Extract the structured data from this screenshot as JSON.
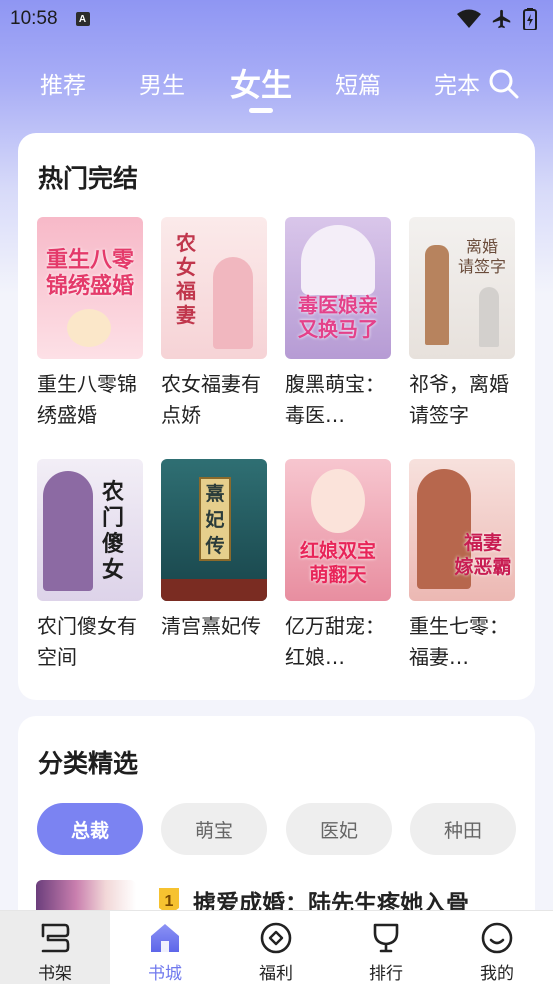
{
  "status_bar": {
    "time": "10:58",
    "notif_letter": "A"
  },
  "top_tabs": [
    {
      "label": "推荐",
      "active": false
    },
    {
      "label": "男生",
      "active": false
    },
    {
      "label": "女生",
      "active": true
    },
    {
      "label": "短篇",
      "active": false
    },
    {
      "label": "完本",
      "active": false
    }
  ],
  "hot_section": {
    "title": "热门完结",
    "books": [
      {
        "title": "重生八零锦绣盛婚",
        "cover_text": "重生八零锦绣盛婚",
        "cover_colors": [
          "#f7b9c8",
          "#fde0e6"
        ]
      },
      {
        "title": "农女福妻有点娇",
        "cover_text": "农女福妻有点娇",
        "cover_colors": [
          "#fbeaea",
          "#f6d3d6"
        ]
      },
      {
        "title": "腹黑萌宝：毒医…",
        "cover_text": "毒医娘亲又换马了",
        "cover_colors": [
          "#d9c6ea",
          "#b69bd4"
        ]
      },
      {
        "title": "祁爷，离婚请签字",
        "cover_text": "离婚请签字",
        "cover_colors": [
          "#f3f1ef",
          "#e7e1dc"
        ]
      },
      {
        "title": "农门傻女有空间",
        "cover_text": "农门傻女",
        "cover_colors": [
          "#f2eef6",
          "#ddd3e9"
        ]
      },
      {
        "title": "清宫熹妃传",
        "cover_text": "熹妃传",
        "cover_colors": [
          "#2f6f73",
          "#18444a"
        ]
      },
      {
        "title": "亿万甜宠：红娘…",
        "cover_text": "红娘双宝萌翻天",
        "cover_colors": [
          "#f7c6cf",
          "#e88ea0"
        ]
      },
      {
        "title": "重生七零：福妻…",
        "cover_text": "福妻嫁恶霸",
        "cover_colors": [
          "#f7e1dd",
          "#ecb8b3"
        ]
      }
    ]
  },
  "category_section": {
    "title": "分类精选",
    "chips": [
      {
        "label": "总裁",
        "active": true
      },
      {
        "label": "萌宝",
        "active": false
      },
      {
        "label": "医妃",
        "active": false
      },
      {
        "label": "种田",
        "active": false
      }
    ],
    "rank_item": {
      "rank": "1",
      "title": "掳爱成婚：陆先生疼她入骨"
    }
  },
  "bottom_nav": [
    {
      "label": "书架",
      "icon": "bookshelf-icon",
      "active": false
    },
    {
      "label": "书城",
      "icon": "home-icon",
      "active": true
    },
    {
      "label": "福利",
      "icon": "coin-icon",
      "active": false
    },
    {
      "label": "排行",
      "icon": "trophy-icon",
      "active": false
    },
    {
      "label": "我的",
      "icon": "smile-icon",
      "active": false
    }
  ],
  "colors": {
    "accent": "#7b83f2",
    "header_gradient_top": "#8f96f3"
  }
}
